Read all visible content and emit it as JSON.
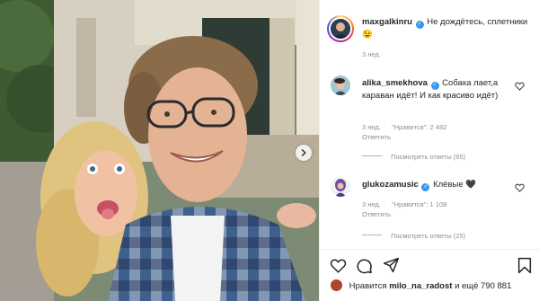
{
  "post": {
    "author": "maxgalkinru",
    "caption": "Не дождётесь, сплетники 😉",
    "time": "3 нед."
  },
  "comments": [
    {
      "username": "alika_smekhova",
      "text": "Собака лает,а караван идёт! И как красиво идёт)",
      "time": "3 нед.",
      "likes": "\"Нравится\": 2 482",
      "reply": "Ответить",
      "view_replies": "Посмотреть ответы (65)",
      "verified": true
    },
    {
      "username": "glukozamusic",
      "text": "Клёвые 🖤",
      "time": "3 нед.",
      "likes": "\"Нравится\": 1 108",
      "reply": "Ответить",
      "view_replies": "Посмотреть ответы (25)",
      "verified": true
    }
  ],
  "footer": {
    "likes_prefix": "Нравится",
    "liker": "milo_na_radost",
    "likes_suffix": "и ещё 790 881"
  },
  "icons": {
    "verified": "verified-badge-icon",
    "like": "heart-icon",
    "comment": "comment-icon",
    "share": "send-icon",
    "save": "bookmark-icon",
    "carousel": "chevron-right-icon"
  },
  "colors": {
    "verified": "#3897f0",
    "muted": "#8e8e8e",
    "text": "#262626"
  }
}
